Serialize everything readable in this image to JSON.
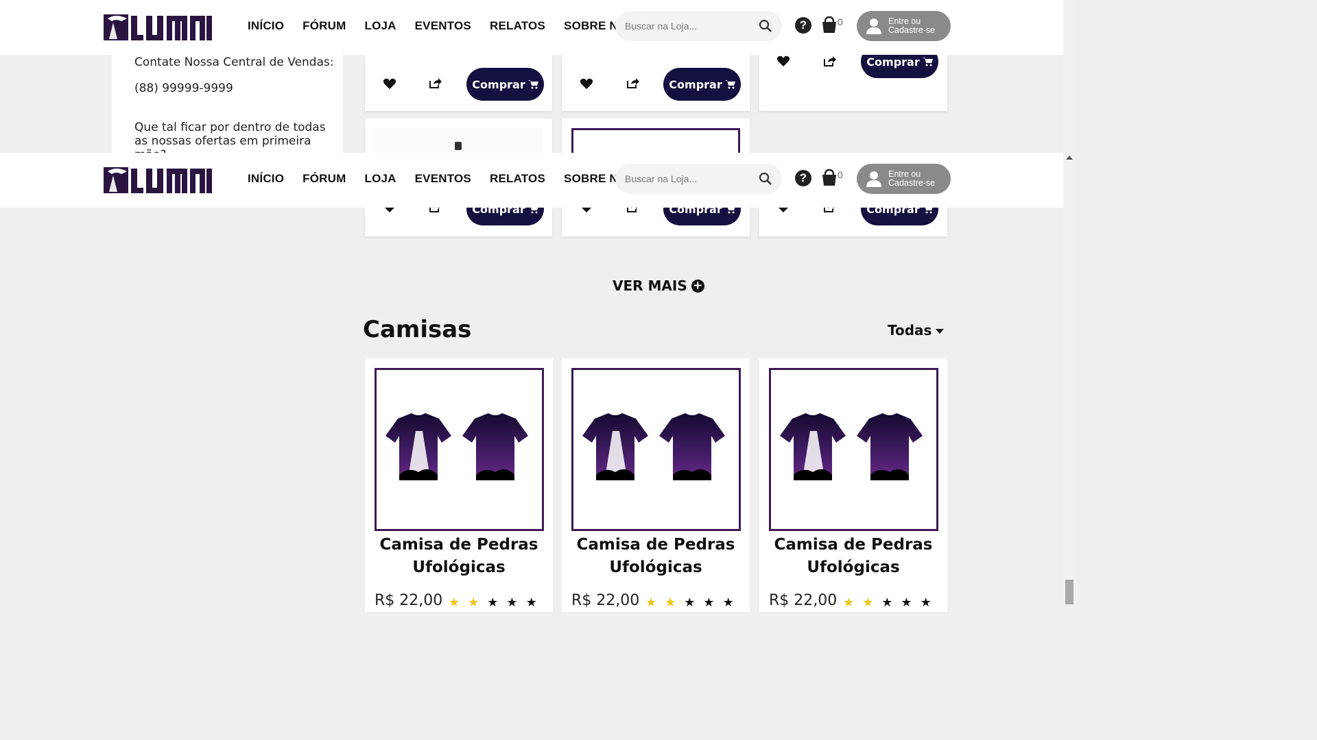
{
  "brand": {
    "logo_text": "LUMNI"
  },
  "nav": [
    "INÍCIO",
    "FÓRUM",
    "LOJA",
    "EVENTOS",
    "RELATOS",
    "SOBRE NÓS"
  ],
  "search": {
    "placeholder": "Buscar na Loja..."
  },
  "help": {
    "label": "?"
  },
  "cart": {
    "count": "0"
  },
  "login": {
    "label": "Entre ou Cadastre-se"
  },
  "sidebar": {
    "contact_label": "Contate Nossa Central de Vendas:",
    "phone": "(88) 99999-9999",
    "promo_text": "Que tal ficar por dentro de todas as nossas ofertas em primeira mão?"
  },
  "product_buy_label": "Comprar",
  "ver_mais": "VER MAIS",
  "section": {
    "title": "Camisas",
    "filter": "Todas"
  },
  "shirts": [
    {
      "name": "Camisa de Pedras Ufológicas",
      "price": "R$ 22,00",
      "rating": 2
    },
    {
      "name": "Camisa de Pedras Ufológicas",
      "price": "R$ 22,00",
      "rating": 2
    },
    {
      "name": "Camisa de Pedras Ufológicas",
      "price": "R$ 22,00",
      "rating": 2
    }
  ],
  "colors": {
    "accent": "#14103f",
    "frame": "#3d1a55",
    "star": "#f0c419"
  }
}
